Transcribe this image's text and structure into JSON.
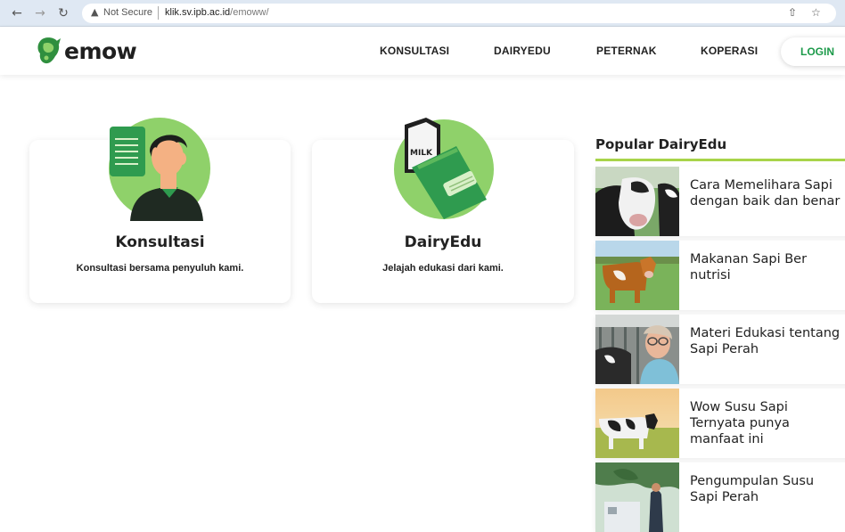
{
  "browser": {
    "security_label": "Not Secure",
    "url_host": "klik.sv.ipb.ac.id",
    "url_path": "/emoww/"
  },
  "site": {
    "logo_text": "emow",
    "nav": [
      "KONSULTASI",
      "DAIRYEDU",
      "PETERNAK",
      "KOPERASI"
    ],
    "login_label": "LOGIN",
    "accent_color": "#1c9a4a"
  },
  "cards": [
    {
      "title": "Konsultasi",
      "description": "Konsultasi bersama penyuluh kami.",
      "icon": "consultant-icon"
    },
    {
      "title": "DairyEdu",
      "description": "Jelajah edukasi dari kami.",
      "icon": "milk-book-icon",
      "milk_label": "MILK"
    }
  ],
  "popular": {
    "title": "Popular DairyEdu",
    "items": [
      {
        "text": "Cara Memelihara Sapi\ndengan baik dan benar"
      },
      {
        "text": "Makanan Sapi Ber\nnutrisi"
      },
      {
        "text": "Materi Edukasi tentang\nSapi Perah"
      },
      {
        "text": "Wow Susu Sapi\nTernyata punya\nmanfaat ini"
      },
      {
        "text": "Pengumpulan Susu\nSapi Perah"
      }
    ]
  }
}
